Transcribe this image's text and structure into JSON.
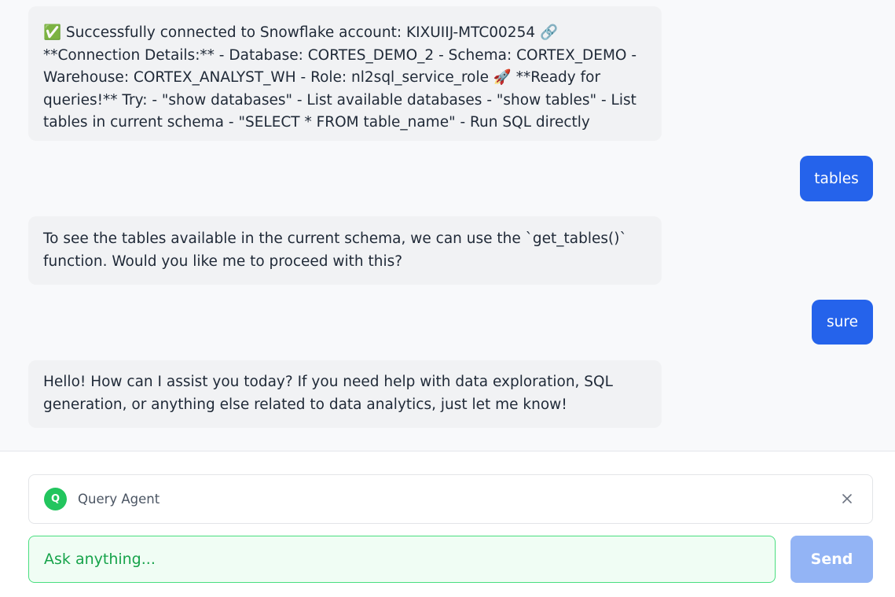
{
  "messages": [
    {
      "role": "assistant",
      "text": "✅ Successfully connected to Snowflake account: KIXUIIJ-MTC00254 🔗 **Connection Details:** - Database: CORTES_DEMO_2 - Schema: CORTEX_DEMO - Warehouse: CORTEX_ANALYST_WH - Role: nl2sql_service_role 🚀 **Ready for queries!** Try: - \"show databases\" - List available databases - \"show tables\" - List tables in current schema - \"SELECT * FROM table_name\" - Run SQL directly"
    },
    {
      "role": "user",
      "text": "tables"
    },
    {
      "role": "assistant",
      "text": "To see the tables available in the current schema, we can use the `get_tables()` function. Would you like me to proceed with this?"
    },
    {
      "role": "user",
      "text": "sure"
    },
    {
      "role": "assistant",
      "text": "Hello! How can I assist you today? If you need help with data exploration, SQL generation, or anything else related to data analytics, just let me know!"
    }
  ],
  "agent": {
    "avatar_letter": "Q",
    "name": "Query Agent",
    "icon": "close-icon"
  },
  "composer": {
    "placeholder": "Ask anything...",
    "send_label": "Send"
  },
  "colors": {
    "user_bubble": "#2563eb",
    "assistant_bubble": "#f1f2f4",
    "agent_avatar": "#22c55e",
    "input_border": "#4ade80",
    "send_disabled": "#93b4f5"
  }
}
